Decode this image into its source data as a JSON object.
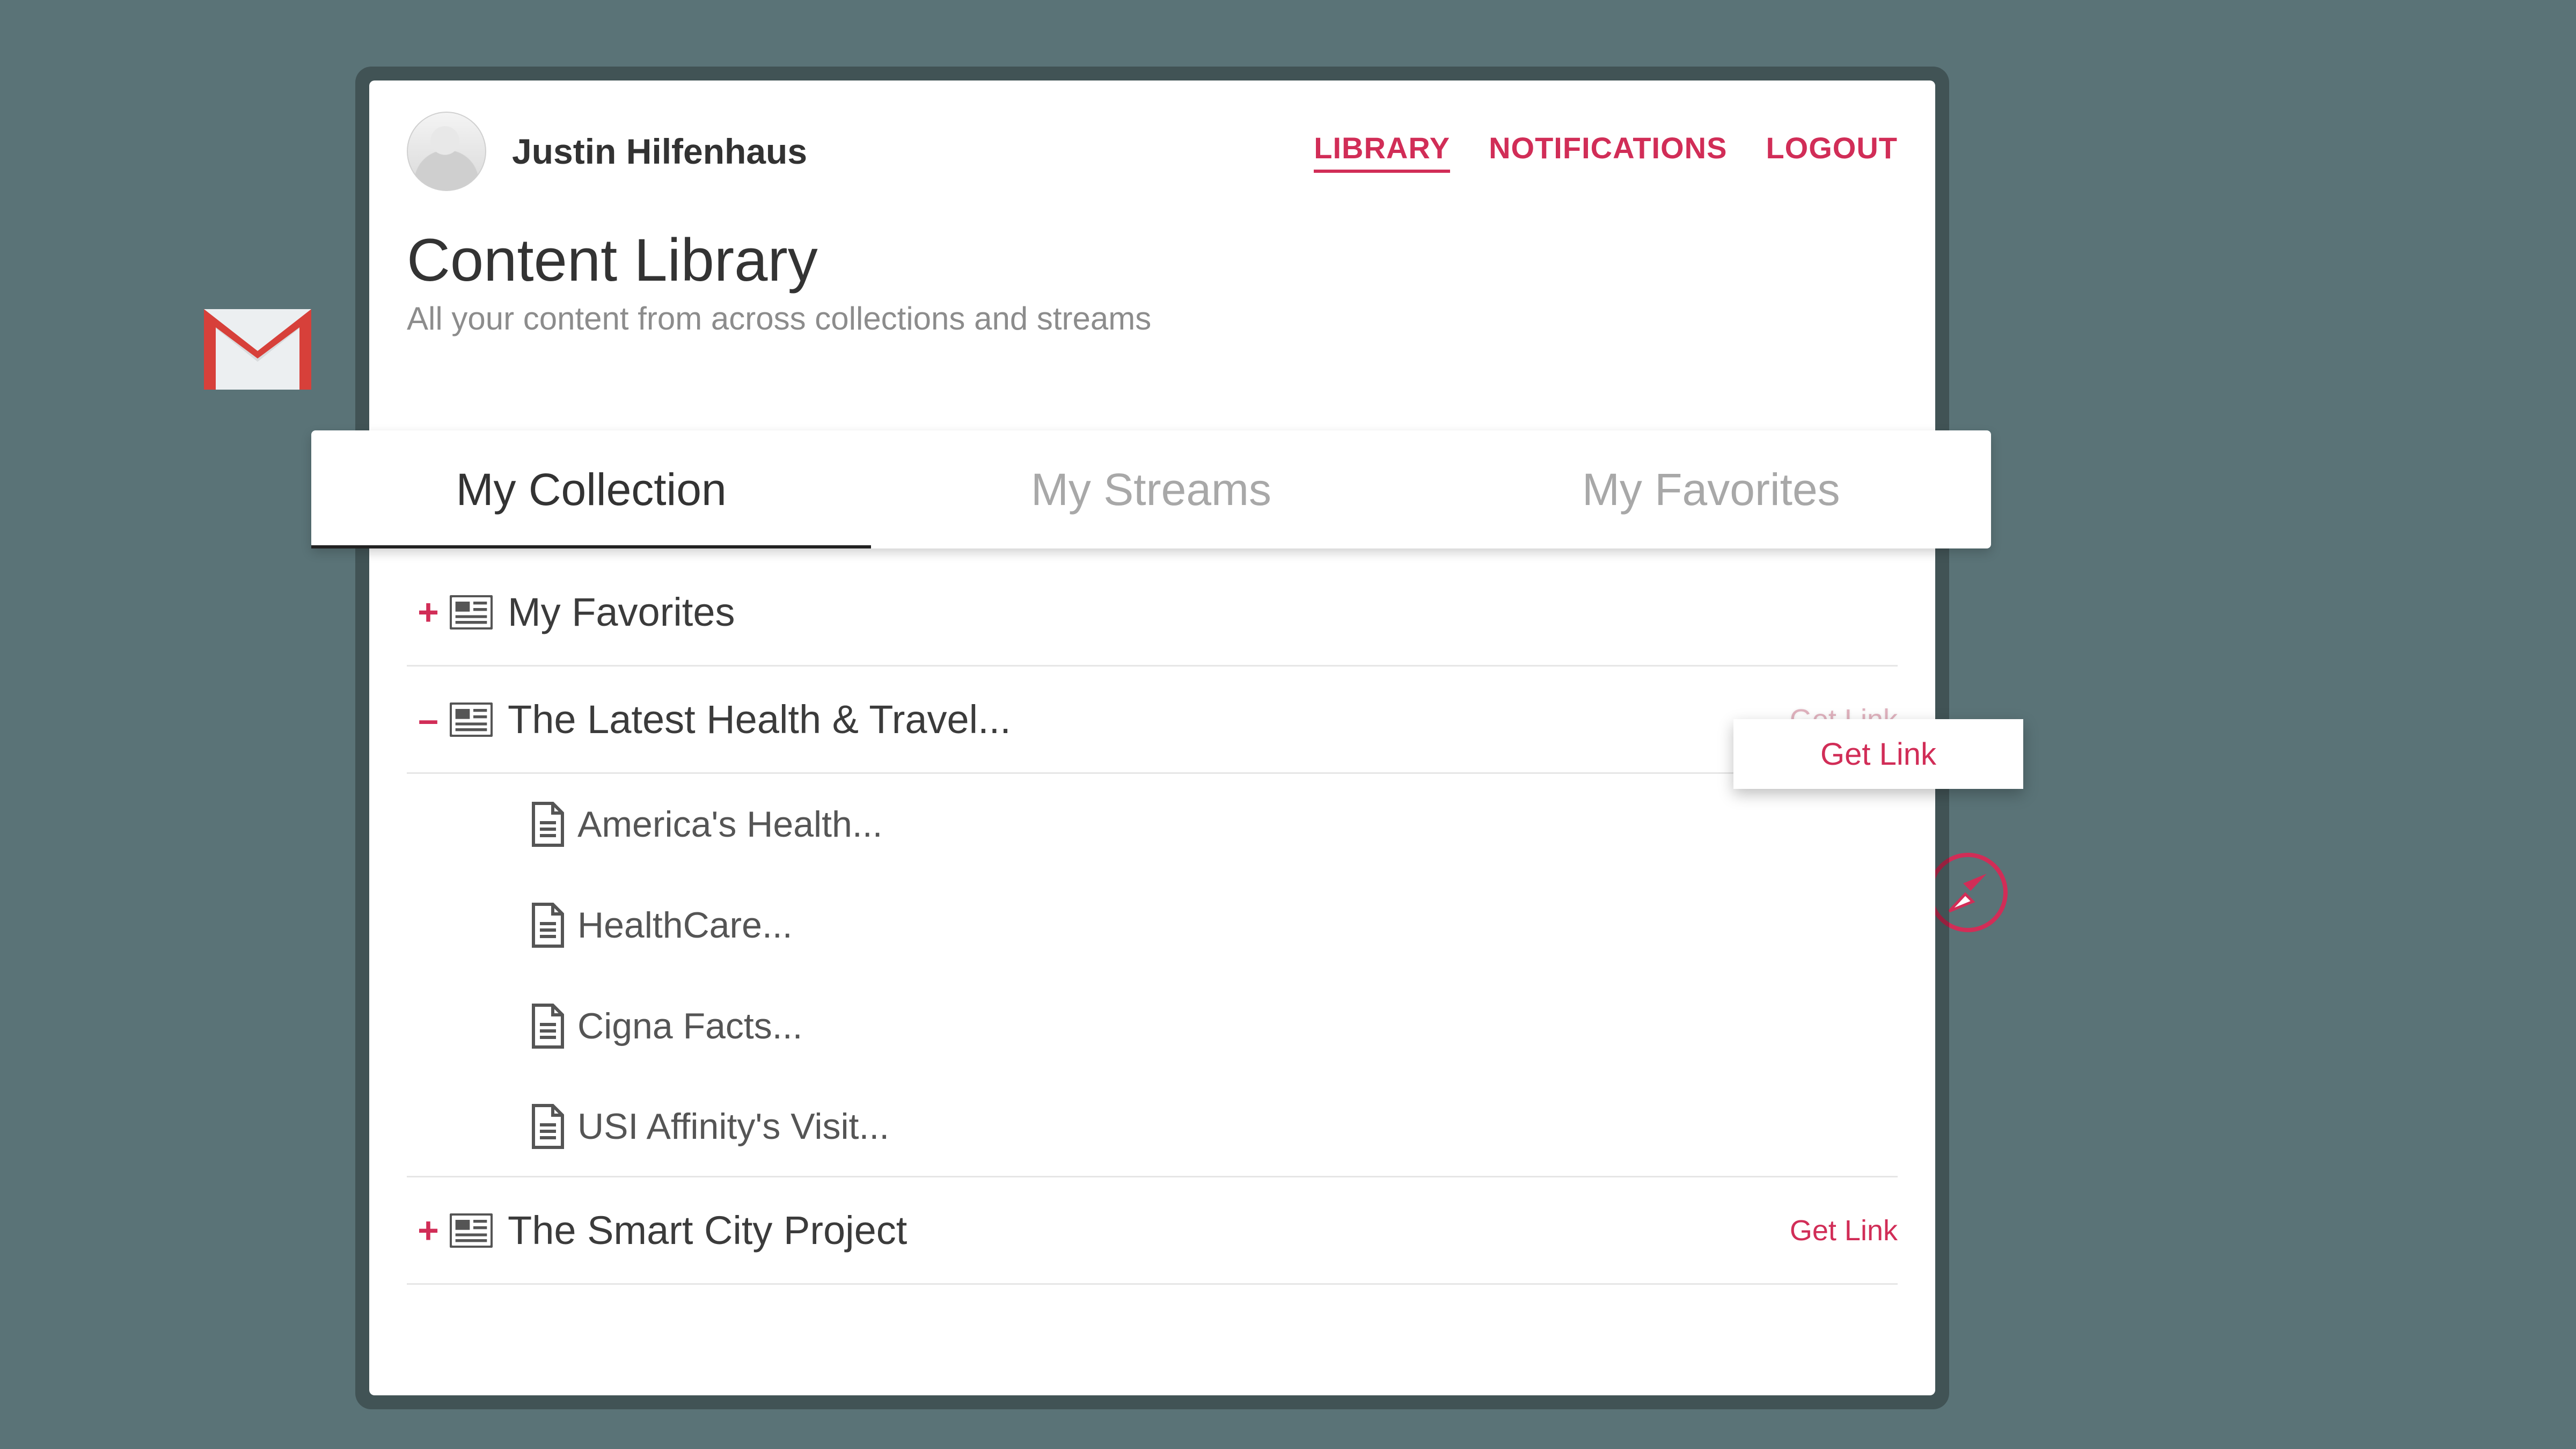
{
  "accent": "#d12d57",
  "user": {
    "name": "Justin Hilfenhaus"
  },
  "nav": {
    "library": "LIBRARY",
    "notifications": "NOTIFICATIONS",
    "logout": "LOGOUT"
  },
  "page": {
    "title": "Content Library",
    "subtitle": "All your content from across collections and streams"
  },
  "tabs": {
    "collection": "My Collection",
    "streams": "My Streams",
    "favorites": "My Favorites"
  },
  "tree": {
    "fav": {
      "toggle": "+",
      "label": "My Favorites"
    },
    "health": {
      "toggle": "–",
      "label": "The Latest Health & Travel...",
      "getlink": "Get Link",
      "children": [
        "America's Health...",
        "HealthCare...",
        "Cigna Facts...",
        "USI Affinity's Visit..."
      ]
    },
    "smart": {
      "toggle": "+",
      "label": "The Smart City Project",
      "getlink": "Get Link"
    }
  },
  "tooltip": "Get Link"
}
